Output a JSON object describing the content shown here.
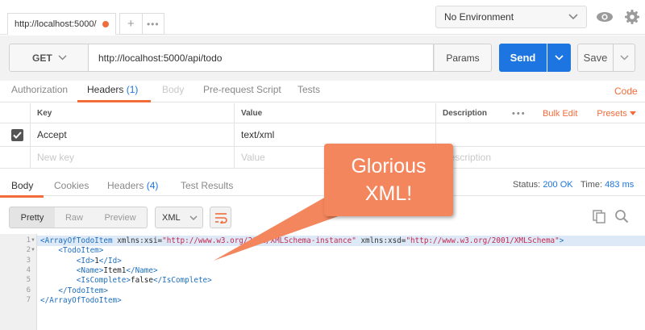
{
  "tab": {
    "title": "http://localhost:5000/",
    "add": "+",
    "more": "•••"
  },
  "environment": {
    "selected": "No Environment"
  },
  "request": {
    "method": "GET",
    "url": "http://localhost:5000/api/todo",
    "params_label": "Params",
    "send_label": "Send",
    "save_label": "Save"
  },
  "request_tabs": {
    "authorization": "Authorization",
    "headers": "Headers",
    "headers_count": "(1)",
    "body": "Body",
    "prerequest": "Pre-request Script",
    "tests": "Tests",
    "code": "Code"
  },
  "headers_table": {
    "columns": {
      "key": "Key",
      "value": "Value",
      "description": "Description"
    },
    "ellipsis": "•••",
    "bulk_edit": "Bulk Edit",
    "presets": "Presets",
    "rows": [
      {
        "key": "Accept",
        "value": "text/xml"
      }
    ],
    "placeholder": {
      "key": "New key",
      "value": "Value",
      "description": "Description"
    }
  },
  "response_tabs": {
    "body": "Body",
    "cookies": "Cookies",
    "headers": "Headers",
    "headers_count": "(4)",
    "test_results": "Test Results",
    "status_label": "Status:",
    "status_value": "200 OK",
    "time_label": "Time:",
    "time_value": "483 ms"
  },
  "response_toolbar": {
    "pretty": "Pretty",
    "raw": "Raw",
    "preview": "Preview",
    "format": "XML"
  },
  "code_lines": [
    {
      "n": "1",
      "text": "<ArrayOfTodoItem xmlns:xsi=\"http://www.w3.org/2001/XMLSchema-instance\" xmlns:xsd=\"http://www.w3.org/2001/XMLSchema\">"
    },
    {
      "n": "2",
      "text": "    <TodoItem>"
    },
    {
      "n": "3",
      "text": "        <Id>1</Id>"
    },
    {
      "n": "4",
      "text": "        <Name>Item1</Name>"
    },
    {
      "n": "5",
      "text": "        <IsComplete>false</IsComplete>"
    },
    {
      "n": "6",
      "text": "    </TodoItem>"
    },
    {
      "n": "7",
      "text": "</ArrayOfTodoItem>"
    }
  ],
  "callout": {
    "line1": "Glorious",
    "line2": "XML!"
  },
  "colors": {
    "accent": "#f26b3a",
    "primary": "#1c75e0",
    "callout": "#f4865e"
  },
  "icons": {
    "eye": "eye-icon",
    "gear": "gear-icon",
    "chevron": "chevron-down-icon",
    "check": "check-icon",
    "wrap": "wrap-lines-icon",
    "copy": "copy-icon",
    "search": "search-icon"
  }
}
